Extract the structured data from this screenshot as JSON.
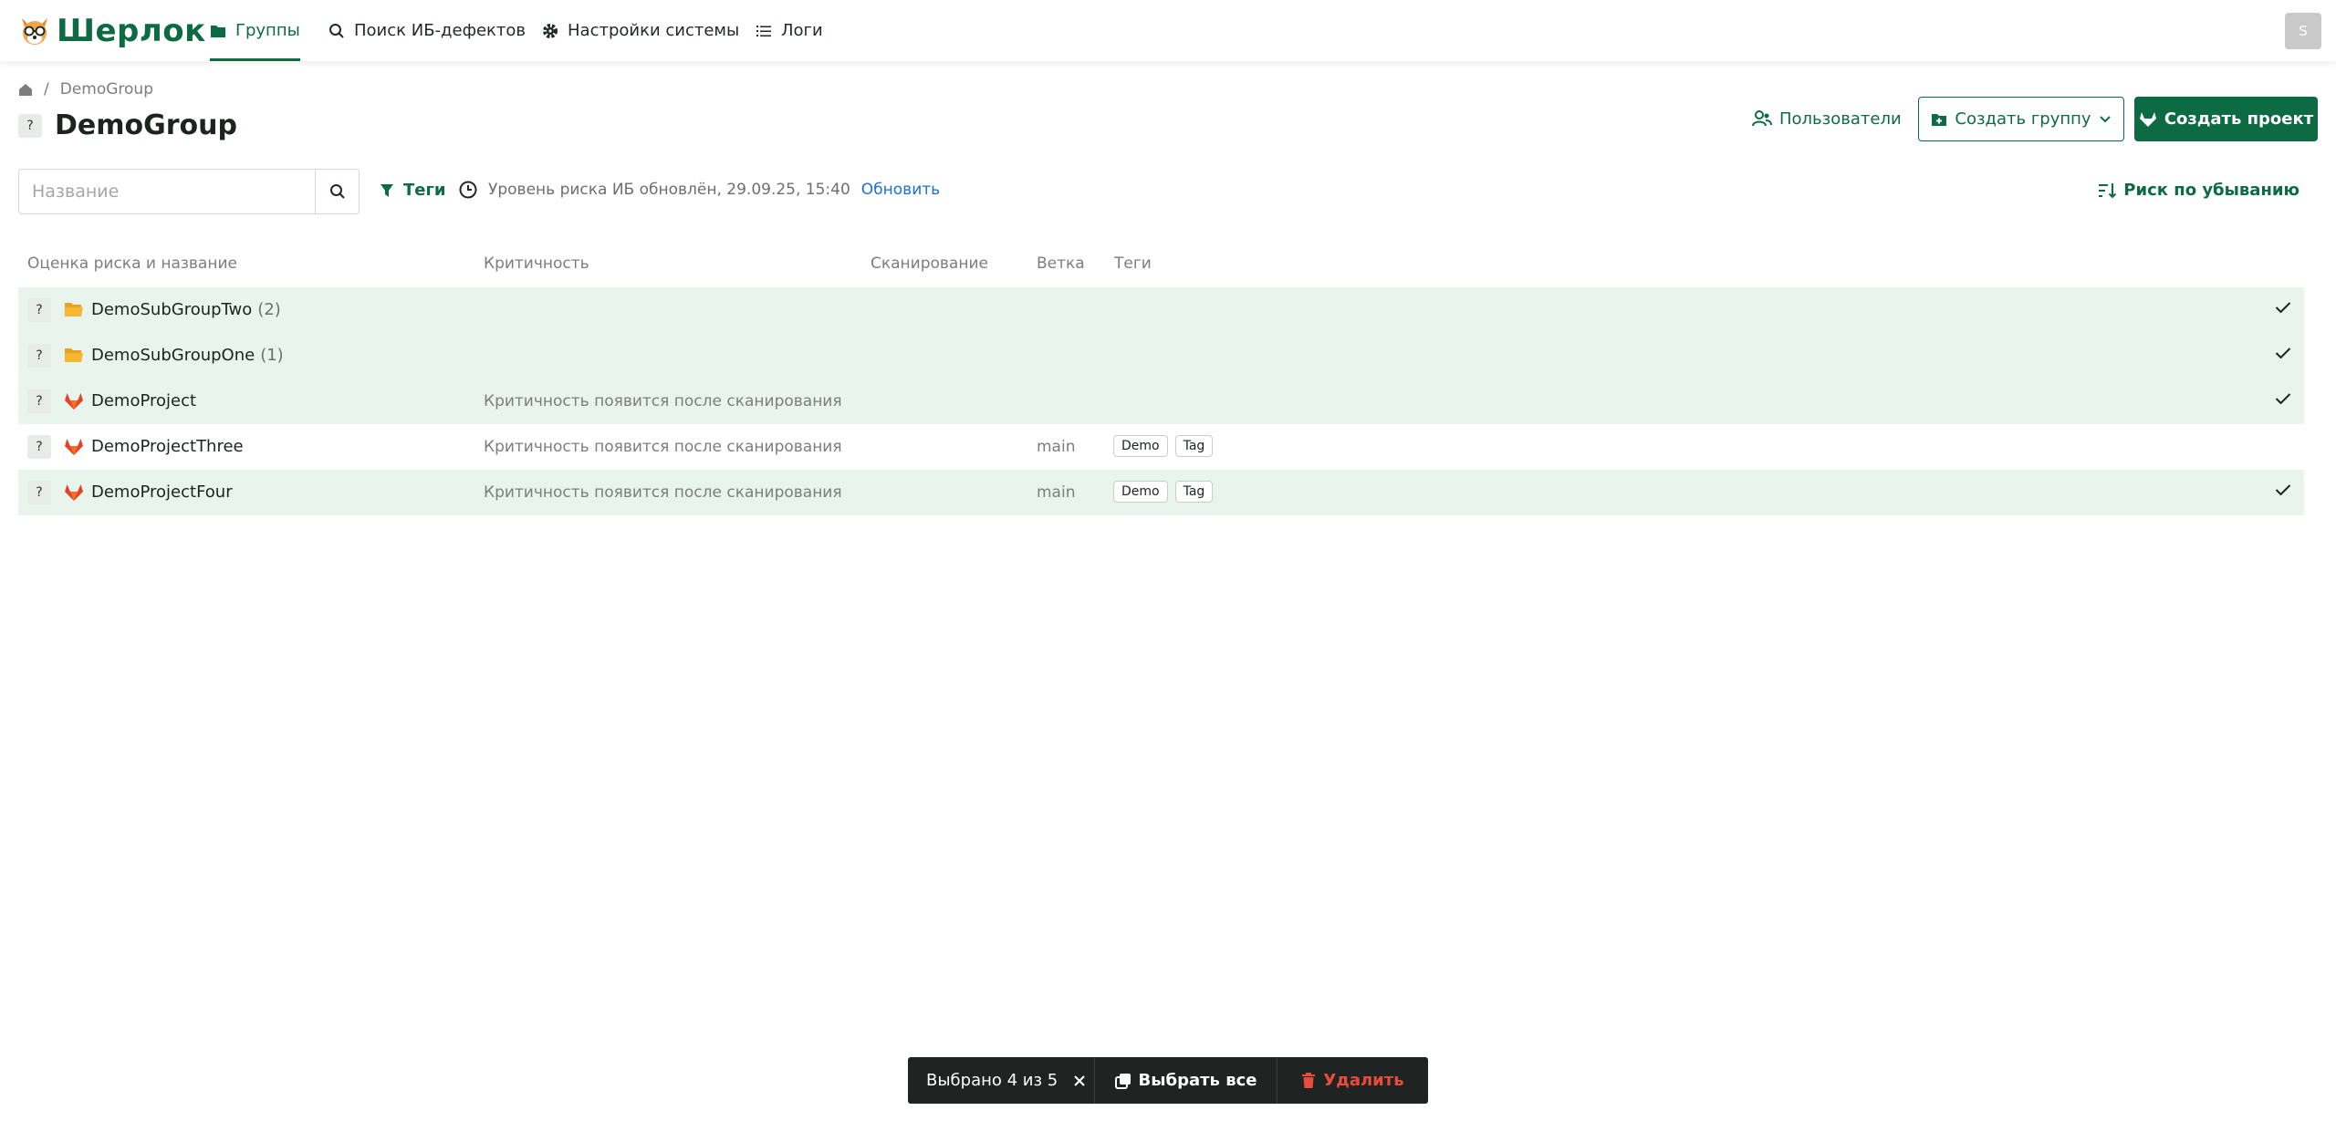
{
  "app": {
    "logo_text": "Шерлок",
    "accent": "#0d6b44"
  },
  "nav": {
    "groups": "Группы",
    "search_defects": "Поиск ИБ-дефектов",
    "settings": "Настройки системы",
    "logs": "Логи"
  },
  "user": {
    "avatar_letter": "S"
  },
  "breadcrumb": {
    "current": "DemoGroup"
  },
  "header": {
    "risk_badge": "?",
    "title": "DemoGroup",
    "users_button": "Пользователи",
    "create_group_button": "Создать группу",
    "create_project_button": "Создать проект"
  },
  "toolbar": {
    "search_placeholder": "Название",
    "tags_filter": "Теги",
    "risk_updated": "Уровень риска ИБ обновлён, 29.09.25, 15:40",
    "refresh": "Обновить",
    "sort": "Риск по убыванию"
  },
  "table": {
    "columns": [
      "Оценка риска и название",
      "Критичность",
      "Сканирование",
      "Ветка",
      "Теги"
    ],
    "rows": [
      {
        "type": "group",
        "risk": "?",
        "name": "DemoSubGroupTwo",
        "count": "(2)",
        "criticality": "",
        "branch": "",
        "tags": [],
        "selected": true
      },
      {
        "type": "group",
        "risk": "?",
        "name": "DemoSubGroupOne",
        "count": "(1)",
        "criticality": "",
        "branch": "",
        "tags": [],
        "selected": true
      },
      {
        "type": "project",
        "risk": "?",
        "name": "DemoProject",
        "count": "",
        "criticality": "Критичность появится после сканирования",
        "branch": "",
        "tags": [],
        "selected": true
      },
      {
        "type": "project",
        "risk": "?",
        "name": "DemoProjectThree",
        "count": "",
        "criticality": "Критичность появится после сканирования",
        "branch": "main",
        "tags": [
          "Demo",
          "Tag"
        ],
        "selected": false
      },
      {
        "type": "project",
        "risk": "?",
        "name": "DemoProjectFour",
        "count": "",
        "criticality": "Критичность появится после сканирования",
        "branch": "main",
        "tags": [
          "Demo",
          "Tag"
        ],
        "selected": true
      }
    ]
  },
  "selection_bar": {
    "selected_text": "Выбрано 4 из 5",
    "select_all": "Выбрать все",
    "delete": "Удалить"
  }
}
